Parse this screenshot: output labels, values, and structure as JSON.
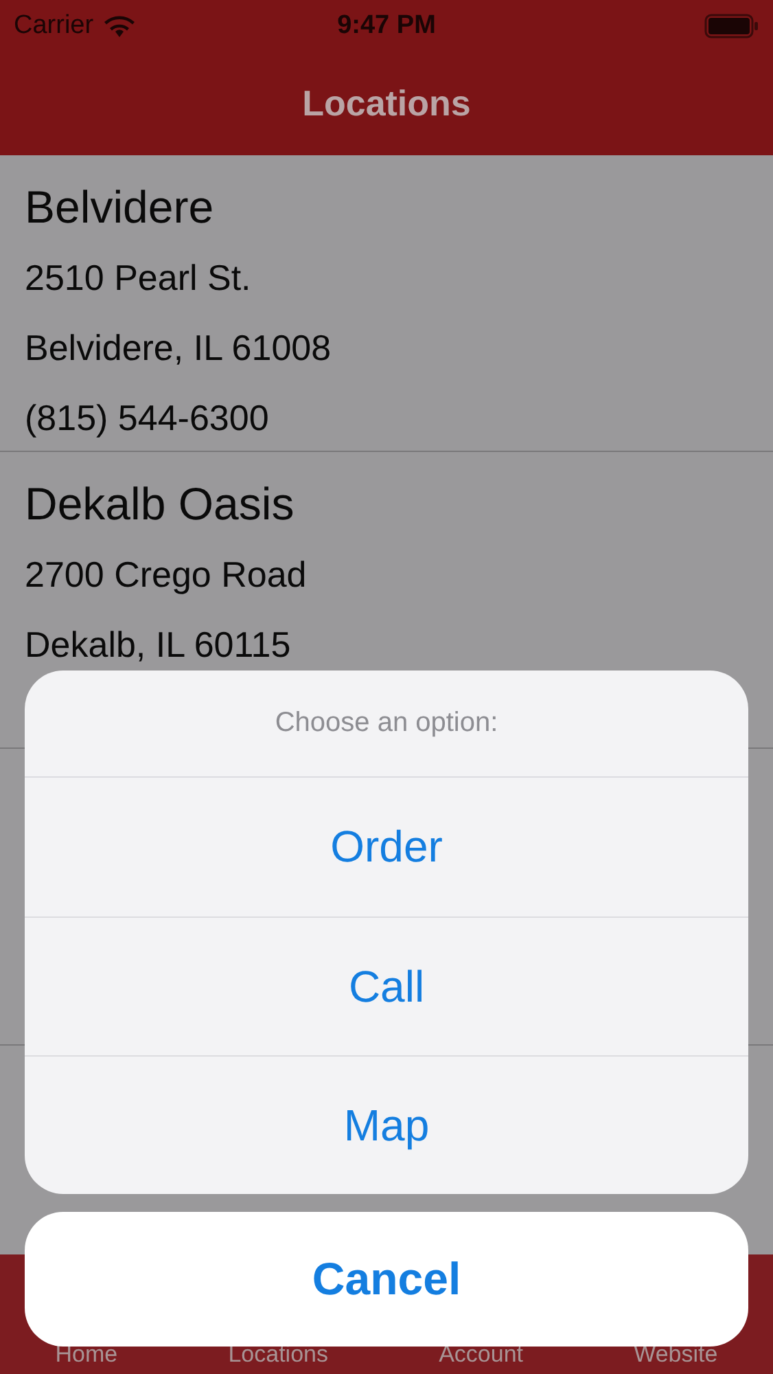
{
  "status_bar": {
    "carrier": "Carrier",
    "time": "9:47 PM"
  },
  "nav_bar": {
    "title": "Locations"
  },
  "locations": [
    {
      "name": "Belvidere",
      "lines": [
        "2510 Pearl St.",
        "Belvidere, IL 61008",
        "(815) 544-6300"
      ]
    },
    {
      "name": "Dekalb Oasis",
      "lines": [
        "2700 Crego Road",
        "Dekalb, IL 60115"
      ]
    }
  ],
  "tab_bar": [
    {
      "label": "Home"
    },
    {
      "label": "Locations"
    },
    {
      "label": "Account"
    },
    {
      "label": "Website"
    }
  ],
  "action_sheet": {
    "title": "Choose an option:",
    "actions": [
      "Order",
      "Call",
      "Map"
    ],
    "cancel": "Cancel"
  }
}
